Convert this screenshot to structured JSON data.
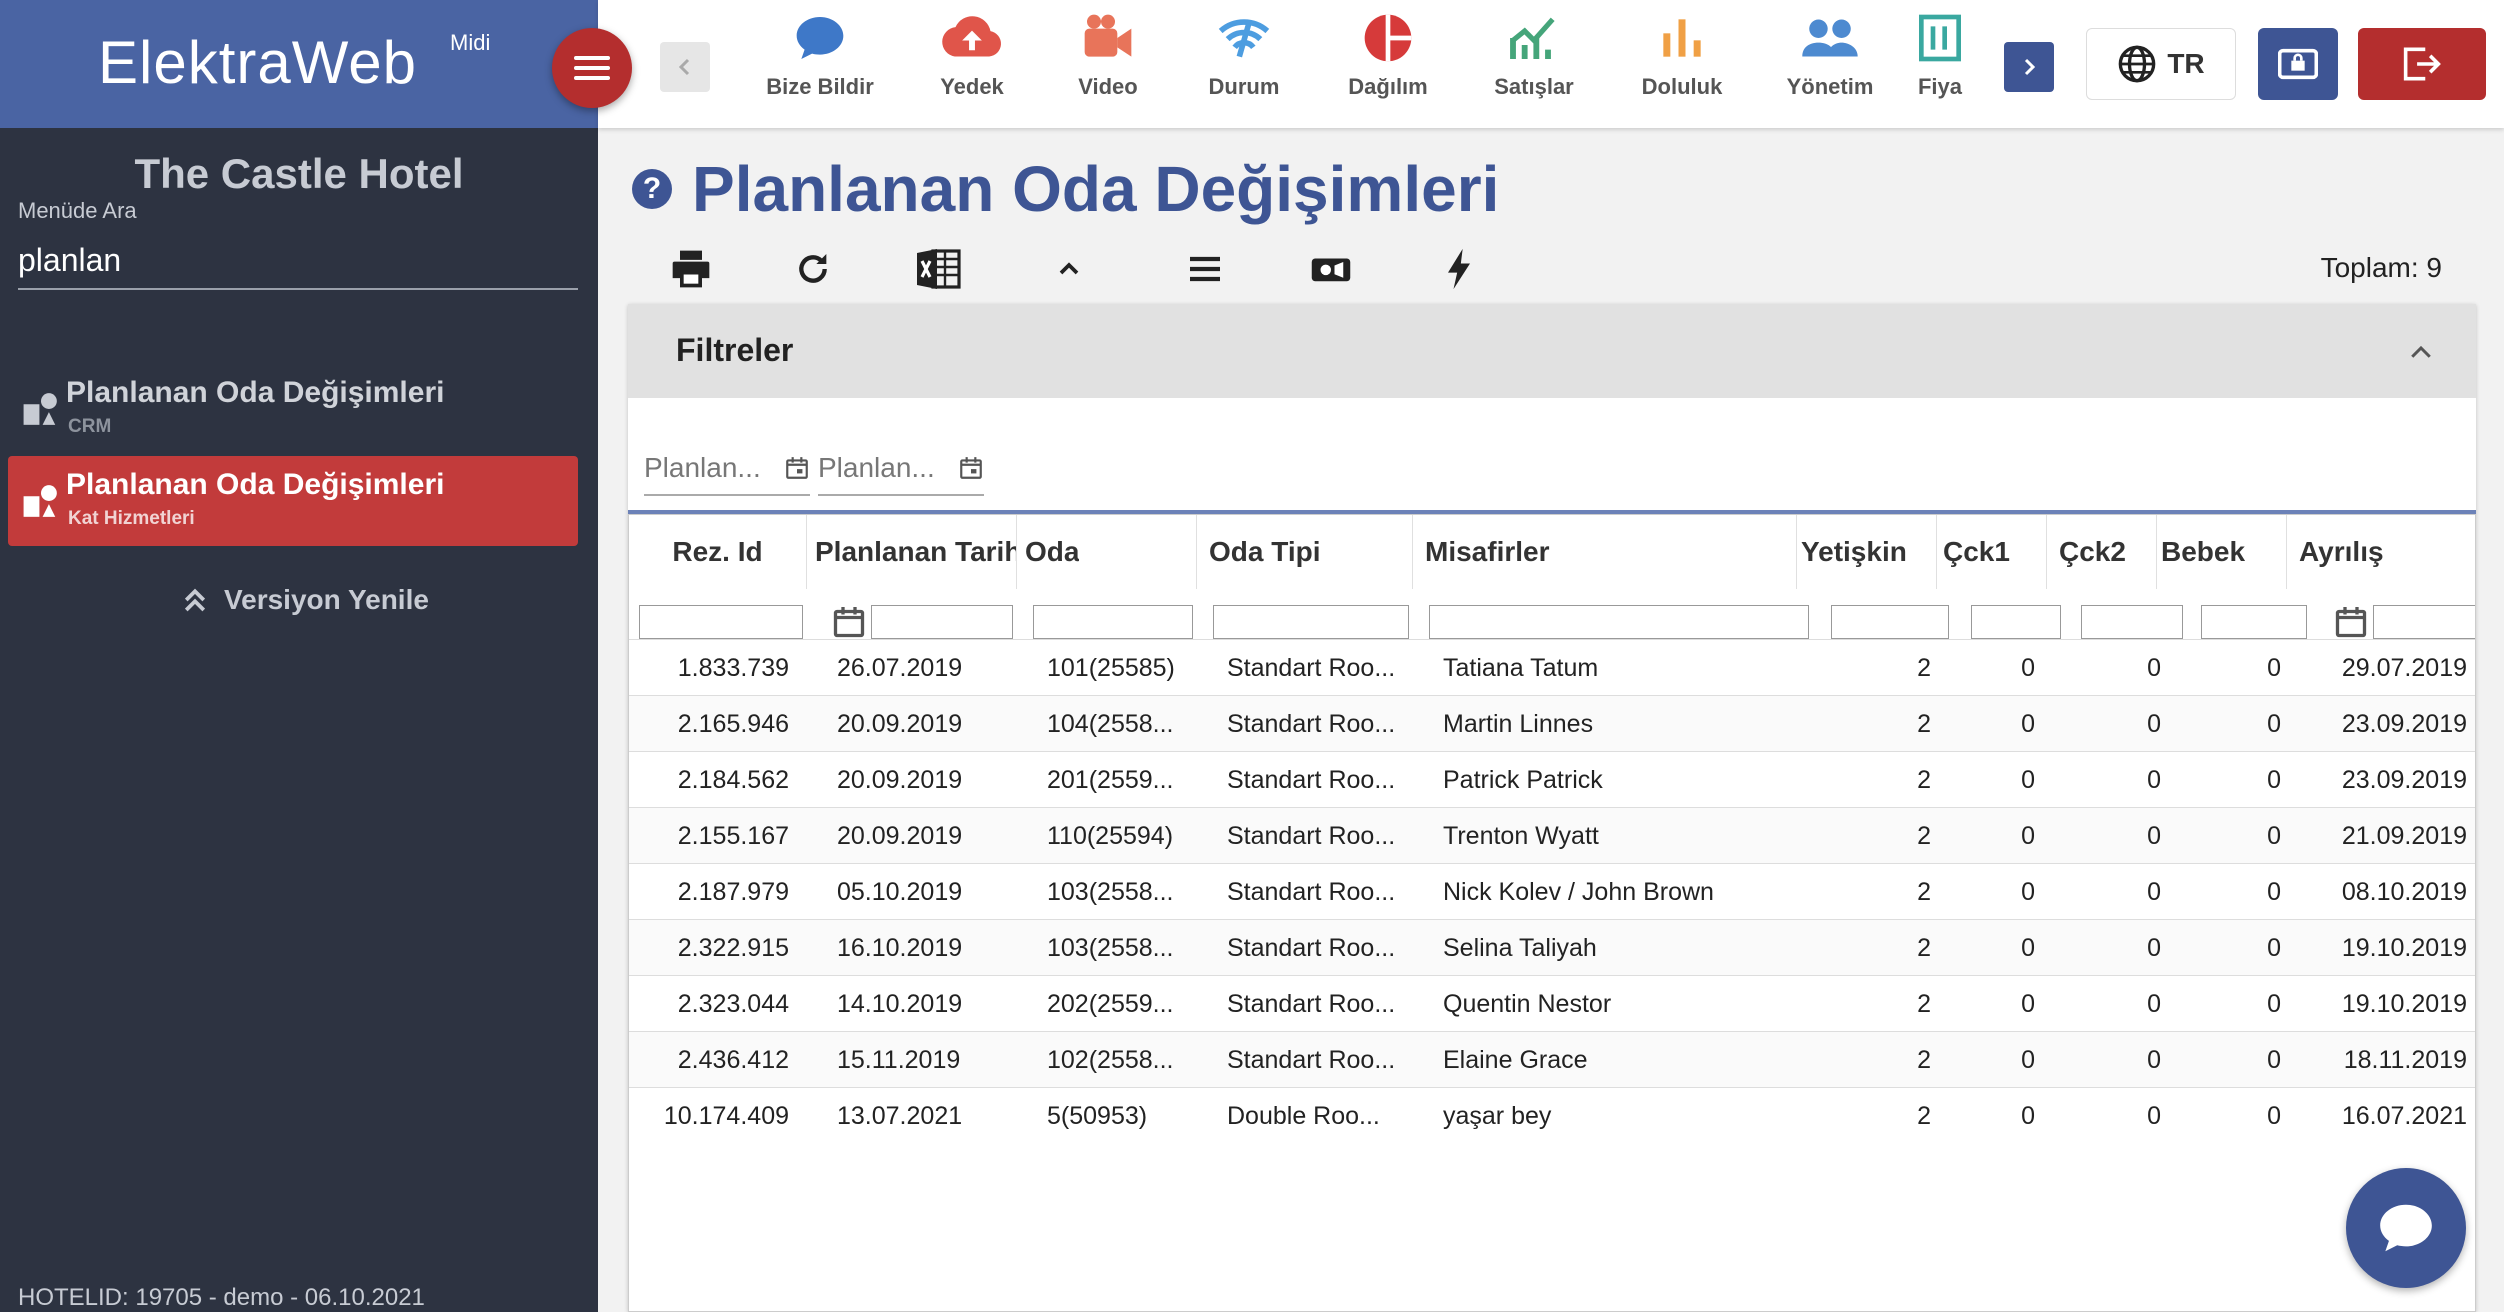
{
  "brand": {
    "name": "ElektraWeb",
    "edition": "Midi"
  },
  "sidebar": {
    "hotel_name": "The Castle Hotel",
    "search_label": "Menüde Ara",
    "search_value": "planlan",
    "items": [
      {
        "title": "Planlanan Oda Değişimleri",
        "module": "CRM",
        "active": false
      },
      {
        "title": "Planlanan Oda Değişimleri",
        "module": "Kat Hizmetleri",
        "active": true
      }
    ],
    "version_label": "Versiyon Yenile",
    "footer": "HOTELID: 19705 - demo - 06.10.2021"
  },
  "toolbar": {
    "tools": [
      {
        "label": "Bize Bildir",
        "icon": "chat-bubble-icon",
        "color": "#3e78c8"
      },
      {
        "label": "Yedek",
        "icon": "cloud-upload-icon",
        "color": "#e0554a"
      },
      {
        "label": "Video",
        "icon": "video-camera-icon",
        "color": "#e8745a"
      },
      {
        "label": "Durum",
        "icon": "wifi-status-icon",
        "color": "#4d9de0"
      },
      {
        "label": "Dağılım",
        "icon": "pie-chart-icon",
        "color": "#d63a3a"
      },
      {
        "label": "Satışlar",
        "icon": "trend-chart-icon",
        "color": "#45a57a"
      },
      {
        "label": "Doluluk",
        "icon": "bar-chart-icon",
        "color": "#f0a045"
      },
      {
        "label": "Yönetim",
        "icon": "people-icon",
        "color": "#4d8ad0"
      },
      {
        "label": "Fiya",
        "icon": "price-icon",
        "color": "#3aa8a0"
      }
    ],
    "language": "TR"
  },
  "page": {
    "title": "Planlanan Oda Değişimleri",
    "total_label": "Toplam: 9"
  },
  "filters": {
    "title": "Filtreler",
    "date_from_placeholder": "Planlan...",
    "date_to_placeholder": "Planlan..."
  },
  "table": {
    "columns": [
      "Rez. Id",
      "Planlanan Tarih",
      "Oda",
      "Oda Tipi",
      "Misafirler",
      "Yetişkin",
      "Çck1",
      "Çck2",
      "Bebek",
      "Ayrılış"
    ],
    "rows": [
      [
        "1.833.739",
        "26.07.2019",
        "101(25585)",
        "Standart Roo...",
        "Tatiana Tatum",
        "2",
        "0",
        "0",
        "0",
        "29.07.2019"
      ],
      [
        "2.165.946",
        "20.09.2019",
        "104(2558...",
        "Standart Roo...",
        "Martin Linnes",
        "2",
        "0",
        "0",
        "0",
        "23.09.2019"
      ],
      [
        "2.184.562",
        "20.09.2019",
        "201(2559...",
        "Standart Roo...",
        "Patrick Patrick",
        "2",
        "0",
        "0",
        "0",
        "23.09.2019"
      ],
      [
        "2.155.167",
        "20.09.2019",
        "110(25594)",
        "Standart Roo...",
        "Trenton Wyatt",
        "2",
        "0",
        "0",
        "0",
        "21.09.2019"
      ],
      [
        "2.187.979",
        "05.10.2019",
        "103(2558...",
        "Standart Roo...",
        "Nick Kolev / John Brown",
        "2",
        "0",
        "0",
        "0",
        "08.10.2019"
      ],
      [
        "2.322.915",
        "16.10.2019",
        "103(2558...",
        "Standart Roo...",
        "Selina Taliyah",
        "2",
        "0",
        "0",
        "0",
        "19.10.2019"
      ],
      [
        "2.323.044",
        "14.10.2019",
        "202(2559...",
        "Standart Roo...",
        "Quentin Nestor",
        "2",
        "0",
        "0",
        "0",
        "19.10.2019"
      ],
      [
        "2.436.412",
        "15.11.2019",
        "102(2558...",
        "Standart Roo...",
        "Elaine Grace",
        "2",
        "0",
        "0",
        "0",
        "18.11.2019"
      ],
      [
        "10.174.409",
        "13.07.2021",
        "5(50953)",
        "Double Roo...",
        "yaşar bey",
        "2",
        "0",
        "0",
        "0",
        "16.07.2021"
      ]
    ]
  }
}
